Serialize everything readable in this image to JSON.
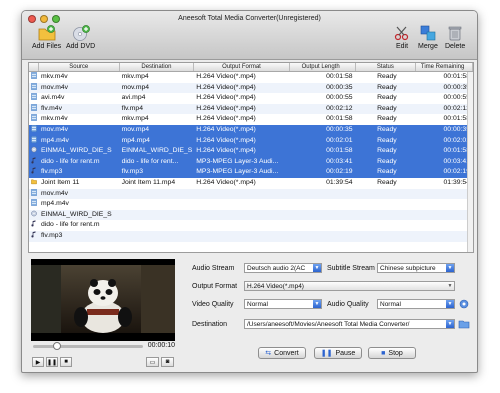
{
  "window": {
    "title": "Aneesoft Total Media Converter(Unregistered)"
  },
  "toolbar": {
    "add_files": "Add Files",
    "add_dvd": "Add DVD",
    "edit": "Edit",
    "merge": "Merge",
    "delete": "Delete"
  },
  "table": {
    "columns": [
      "",
      "Source",
      "Destination",
      "Output Format",
      "Output Length",
      "Status",
      "Time Remaining"
    ],
    "rows": [
      {
        "icon": "video-file-icon",
        "source": "mkv.m4v",
        "dest": "mkv.mp4",
        "format": "H.264 Video(*.mp4)",
        "length": "00:01:58",
        "status": "Ready",
        "remaining": "00:01:58",
        "selected": false
      },
      {
        "icon": "video-file-icon",
        "source": "mov.m4v",
        "dest": "mov.mp4",
        "format": "H.264 Video(*.mp4)",
        "length": "00:00:35",
        "status": "Ready",
        "remaining": "00:00:35",
        "selected": false
      },
      {
        "icon": "video-file-icon",
        "source": "avi.m4v",
        "dest": "avi.mp4",
        "format": "H.264 Video(*.mp4)",
        "length": "00:00:55",
        "status": "Ready",
        "remaining": "00:00:55",
        "selected": false
      },
      {
        "icon": "video-file-icon",
        "source": "flv.m4v",
        "dest": "flv.mp4",
        "format": "H.264 Video(*.mp4)",
        "length": "00:02:12",
        "status": "Ready",
        "remaining": "00:02:12",
        "selected": false
      },
      {
        "icon": "video-file-icon",
        "source": "mkv.m4v",
        "dest": "mkv.mp4",
        "format": "H.264 Video(*.mp4)",
        "length": "00:01:58",
        "status": "Ready",
        "remaining": "00:01:58",
        "selected": false
      },
      {
        "icon": "video-file-icon",
        "source": "mov.m4v",
        "dest": "mov.mp4",
        "format": "H.264 Video(*.mp4)",
        "length": "00:00:35",
        "status": "Ready",
        "remaining": "00:00:35",
        "selected": true
      },
      {
        "icon": "video-file-icon",
        "source": "mp4.m4v",
        "dest": "mp4.mp4",
        "format": "H.264 Video(*.mp4)",
        "length": "00:02:01",
        "status": "Ready",
        "remaining": "00:02:01",
        "selected": true
      },
      {
        "icon": "disc-icon",
        "source": "EINMAL_WIRD_DIE_S",
        "dest": "EINMAL_WIRD_DIE_S",
        "format": "H.264 Video(*.mp4)",
        "length": "00:01:58",
        "status": "Ready",
        "remaining": "00:01:58",
        "selected": true
      },
      {
        "icon": "audio-file-icon",
        "source": "dido - life for rent.m",
        "dest": "dido - life for rent...",
        "format": "MP3-MPEG Layer-3 Audi...",
        "length": "00:03:41",
        "status": "Ready",
        "remaining": "00:03:41",
        "selected": true
      },
      {
        "icon": "audio-file-icon",
        "source": "flv.mp3",
        "dest": "flv.mp3",
        "format": "MP3-MPEG Layer-3 Audi...",
        "length": "00:02:19",
        "status": "Ready",
        "remaining": "00:02:19",
        "selected": true
      },
      {
        "icon": "folder-icon",
        "source": "Joint Item 11",
        "dest": "Joint Item 11.mp4",
        "format": "H.264 Video(*.mp4)",
        "length": "01:39:54",
        "status": "Ready",
        "remaining": "01:39:54",
        "selected": false
      },
      {
        "icon": "video-file-icon",
        "source": "mov.m4v",
        "dest": "",
        "format": "",
        "length": "",
        "status": "",
        "remaining": "",
        "selected": false
      },
      {
        "icon": "video-file-icon",
        "source": "mp4.m4v",
        "dest": "",
        "format": "",
        "length": "",
        "status": "",
        "remaining": "",
        "selected": false
      },
      {
        "icon": "disc-icon",
        "source": "EINMAL_WIRD_DIE_S",
        "dest": "",
        "format": "",
        "length": "",
        "status": "",
        "remaining": "",
        "selected": false
      },
      {
        "icon": "audio-file-icon",
        "source": "dido - life for rent.m",
        "dest": "",
        "format": "",
        "length": "",
        "status": "",
        "remaining": "",
        "selected": false
      },
      {
        "icon": "audio-file-icon",
        "source": "flv.mp3",
        "dest": "",
        "format": "",
        "length": "",
        "status": "",
        "remaining": "",
        "selected": false
      }
    ]
  },
  "player": {
    "time": "00:00:10",
    "progress": 0.22
  },
  "settings": {
    "audio_stream_label": "Audio Stream",
    "audio_stream_value": "Deutsch audio 2(AC",
    "subtitle_stream_label": "Subtitle Stream",
    "subtitle_stream_value": "Chinese subpicture",
    "output_format_label": "Output Format",
    "output_format_value": "H.264 Video(*.mp4)",
    "video_quality_label": "Video Quality",
    "video_quality_value": "Normal",
    "audio_quality_label": "Audio Quality",
    "audio_quality_value": "Normal",
    "destination_label": "Destination",
    "destination_value": "/Users/aneesoft/Movies/Aneesoft Total Media Converter/"
  },
  "actions": {
    "convert": "Convert",
    "pause": "Pause",
    "stop": "Stop"
  },
  "colors": {
    "selection": "#3d74d6",
    "accent": "#2c63cf"
  }
}
